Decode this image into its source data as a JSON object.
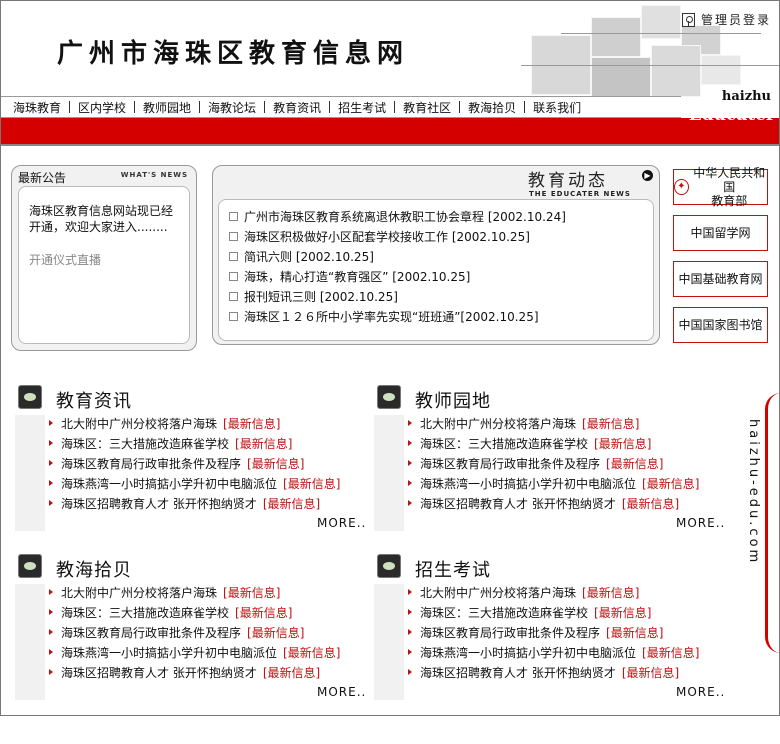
{
  "header": {
    "title": "广州市海珠区教育信息网",
    "admin_login": "管理员登录",
    "brand_sub": "haizhu",
    "brand_main": "Educater"
  },
  "nav": [
    "海珠教育",
    "区内学校",
    "教师园地",
    "海教论坛",
    "教育资讯",
    "招生考试",
    "教育社区",
    "教海拾贝",
    "联系我们"
  ],
  "notice": {
    "heading": "最新公告",
    "tag": "WHAT'S NEWS",
    "text": "海珠区教育信息网站现已经开通，欢迎大家进入........",
    "link": "开通仪式直播"
  },
  "dynamics": {
    "title": "教育动态",
    "tag": "THE EDUCATER NEWS",
    "items": [
      "广州市海珠区教育系统离退休教职工协会章程 [2002.10.24]",
      "海珠区积极做好小区配套学校接收工作 [2002.10.25]",
      "简讯六则 [2002.10.25]",
      "海珠，精心打造“教育强区” [2002.10.25]",
      "报刊短讯三则 [2002.10.25]",
      "海珠区１２６所中小学率先实现“班班通”[2002.10.25]"
    ]
  },
  "side_links": {
    "moe_line1": "中华人民共和国",
    "moe_line2": "教育部",
    "study_abroad": "中国留学网",
    "basic_edu": "中国基础教育网",
    "library": "中国国家图书馆"
  },
  "sections": [
    {
      "title": "教育资讯",
      "items": [
        "北大附中广州分校将落户海珠",
        "海珠区：三大措施改造麻雀学校",
        "海珠区教育局行政审批条件及程序",
        "海珠燕湾一小时搞掂小学升初中电脑派位",
        "海珠区招聘教育人才 张开怀抱纳贤才"
      ],
      "badge": "[最新信息]",
      "more": "MORE.."
    },
    {
      "title": "教师园地",
      "items": [
        "北大附中广州分校将落户海珠",
        "海珠区：三大措施改造麻雀学校",
        "海珠区教育局行政审批条件及程序",
        "海珠燕湾一小时搞掂小学升初中电脑派位",
        "海珠区招聘教育人才 张开怀抱纳贤才"
      ],
      "badge": "[最新信息]",
      "more": "MORE.."
    },
    {
      "title": "教海拾贝",
      "items": [
        "北大附中广州分校将落户海珠",
        "海珠区：三大措施改造麻雀学校",
        "海珠区教育局行政审批条件及程序",
        "海珠燕湾一小时搞掂小学升初中电脑派位",
        "海珠区招聘教育人才 张开怀抱纳贤才"
      ],
      "badge": "[最新信息]",
      "more": "MORE.."
    },
    {
      "title": "招生考试",
      "items": [
        "北大附中广州分校将落户海珠",
        "海珠区：三大措施改造麻雀学校",
        "海珠区教育局行政审批条件及程序",
        "海珠燕湾一小时搞掂小学升初中电脑派位",
        "海珠区招聘教育人才 张开怀抱纳贤才"
      ],
      "badge": "[最新信息]",
      "more": "MORE.."
    }
  ],
  "vertical_brand": "haizhu-edu.com",
  "colors": {
    "accent_red": "#d40000",
    "panel_gray": "#f1f1f1"
  }
}
